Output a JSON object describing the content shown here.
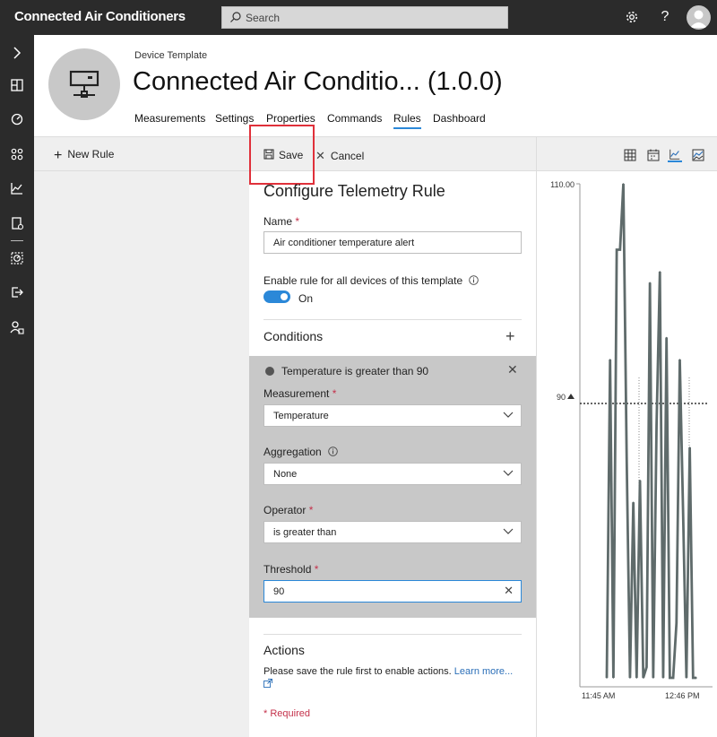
{
  "app": {
    "title": "Connected Air Conditioners"
  },
  "search": {
    "placeholder": "Search"
  },
  "topbar_icons": [
    "gear-icon",
    "help-icon",
    "avatar"
  ],
  "rail": [
    "chevron-right-icon",
    "dashboard-icon",
    "device-explorer-icon",
    "device-templates-icon",
    "analytics-icon",
    "jobs-icon",
    "continuous-export-icon",
    "export-icon",
    "administration-icon"
  ],
  "header": {
    "subtitle": "Device Template",
    "title": "Connected Air Conditio...  (1.0.0)",
    "tabs": [
      "Measurements",
      "Settings",
      "Properties",
      "Commands",
      "Rules",
      "Dashboard"
    ],
    "active_tab": "Rules"
  },
  "left_toolbar": {
    "new_rule": "New Rule"
  },
  "mid_toolbar": {
    "save": "Save",
    "cancel": "Cancel"
  },
  "form": {
    "title": "Configure Telemetry Rule",
    "name_label": "Name",
    "required_mark": "*",
    "name_value": "Air conditioner temperature alert",
    "enable_label": "Enable rule for all devices of this template",
    "toggle_state": "On",
    "conditions_heading": "Conditions",
    "condition": {
      "summary": "Temperature is greater than 90",
      "measurement_label": "Measurement",
      "measurement_value": "Temperature",
      "aggregation_label": "Aggregation",
      "aggregation_value": "None",
      "operator_label": "Operator",
      "operator_value": "is greater than",
      "threshold_label": "Threshold",
      "threshold_value": "90"
    },
    "actions_heading": "Actions",
    "actions_text": "Please save the rule first to enable actions.",
    "learn_more": "Learn more...",
    "required_note": "* Required"
  },
  "chart_toolbar": [
    "grid-icon",
    "calendar-icon",
    "line-chart-icon",
    "area-chart-icon"
  ],
  "chart_data": {
    "type": "line",
    "y_max_label": "110.00",
    "threshold_label": "90",
    "x_tick_labels": [
      "11:45 AM",
      "12:46 PM"
    ],
    "ylim": [
      0,
      110
    ],
    "threshold": 90,
    "series": [
      {
        "values": [
          48,
          94,
          28,
          104,
          104,
          120,
          85,
          28,
          81,
          31,
          83,
          57,
          66,
          101,
          41,
          88,
          102,
          57,
          96,
          65,
          56,
          70,
          94,
          80,
          44,
          86,
          61,
          51
        ]
      }
    ],
    "threshold_line": "dotted",
    "grid": false
  },
  "colors": {
    "topbar": "#2b2b2b",
    "accent": "#2b88d8",
    "highlight": "#e0303a",
    "series": "#5f6b6b"
  }
}
